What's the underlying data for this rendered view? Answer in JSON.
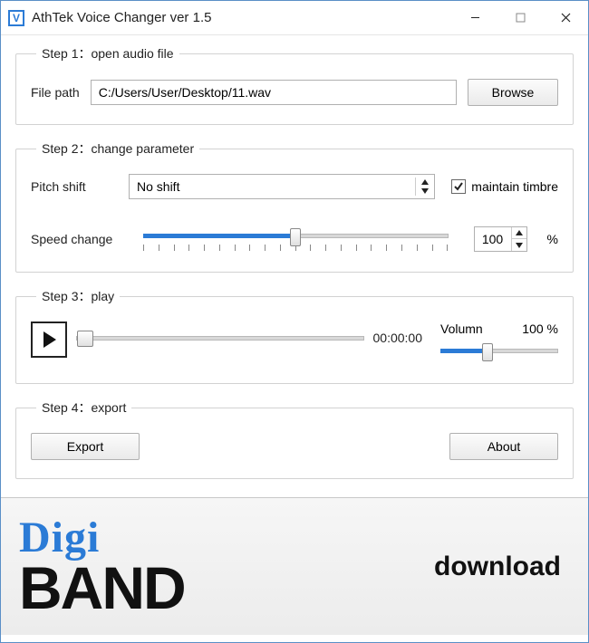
{
  "window": {
    "title": "AthTek Voice Changer ver 1.5"
  },
  "step1": {
    "legend": "Step 1：open audio file",
    "filepath_label": "File path",
    "filepath_value": "C:/Users/User/Desktop/11.wav",
    "browse_label": "Browse"
  },
  "step2": {
    "legend": "Step 2：change parameter",
    "pitch_label": "Pitch shift",
    "pitch_value": "No shift",
    "maintain_label": "maintain timbre",
    "maintain_checked": true,
    "speed_label": "Speed change",
    "speed_value": "100",
    "speed_unit": "%"
  },
  "step3": {
    "legend": "Step 3：play",
    "timecode": "00:00:00",
    "volume_label": "Volumn",
    "volume_value": "100 %"
  },
  "step4": {
    "legend": "Step 4：export",
    "export_label": "Export",
    "about_label": "About"
  },
  "banner": {
    "logo_top": "Digi",
    "logo_bottom": "BAND",
    "download_label": "download"
  }
}
